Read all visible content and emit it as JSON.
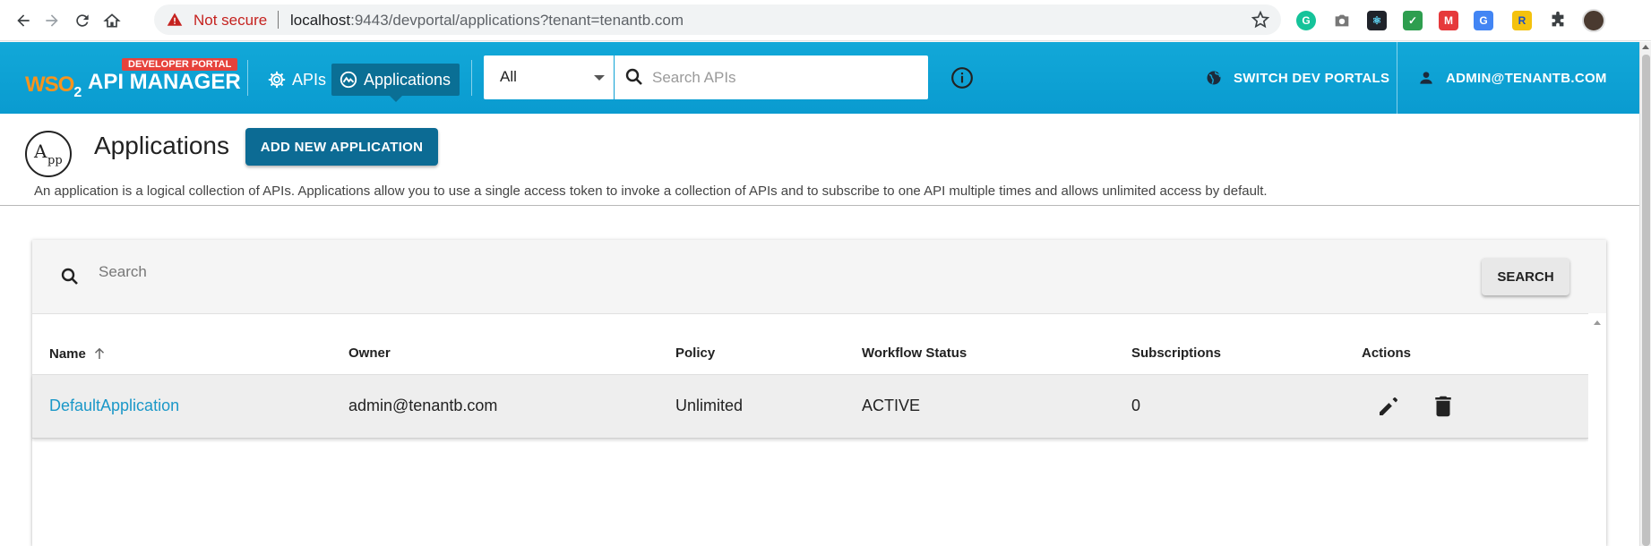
{
  "browser": {
    "security_label": "Not secure",
    "url_host": "localhost",
    "url_rest": ":9443/devportal/applications?tenant=tenantb.com"
  },
  "header": {
    "logo_wso2": "WSO",
    "logo_sub": "2",
    "logo_title": "API MANAGER",
    "logo_badge": "DEVELOPER PORTAL",
    "nav_apis": "APIs",
    "nav_applications": "Applications",
    "scope_selected": "All",
    "search_placeholder": "Search APIs",
    "switch_portals": "SWITCH DEV PORTALS",
    "user": "ADMIN@TENANTB.COM"
  },
  "page": {
    "title": "Applications",
    "add_button": "ADD NEW APPLICATION",
    "description": "An application is a logical collection of APIs. Applications allow you to use a single access token to invoke a collection of APIs and to subscribe to one API multiple times and allows unlimited access by default."
  },
  "toolbar": {
    "search_placeholder": "Search",
    "search_button": "SEARCH"
  },
  "table": {
    "columns": [
      "Name",
      "Owner",
      "Policy",
      "Workflow Status",
      "Subscriptions",
      "Actions"
    ],
    "rows": [
      {
        "name": "DefaultApplication",
        "owner": "admin@tenantb.com",
        "policy": "Unlimited",
        "workflow_status": "ACTIVE",
        "subscriptions": "0"
      }
    ]
  },
  "colors": {
    "header_blue": "#0a9bd0",
    "active_nav": "#0a6f95",
    "primary_button": "#0c6b94",
    "link": "#1b98c8",
    "badge_red": "#e6423c",
    "wso2_orange": "#f7941d"
  },
  "icons": [
    "back-icon",
    "forward-icon",
    "reload-icon",
    "home-icon",
    "warning-icon",
    "star-icon",
    "gear-icon",
    "applications-icon",
    "search-icon",
    "info-icon",
    "globe-icon",
    "user-icon",
    "sort-ascending-icon",
    "edit-icon",
    "delete-icon",
    "app-logo-icon"
  ]
}
